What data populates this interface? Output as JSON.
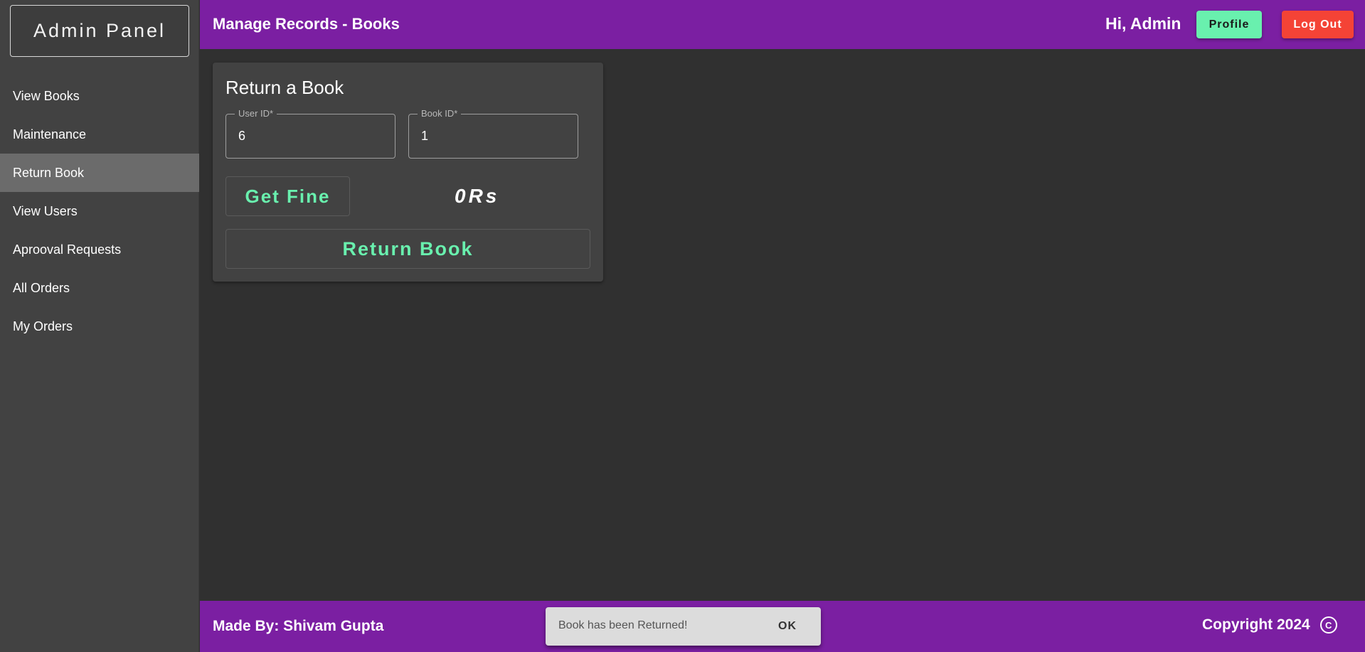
{
  "sidebar": {
    "brand": "Admin Panel",
    "items": [
      {
        "label": "View Books",
        "active": false
      },
      {
        "label": "Maintenance",
        "active": false
      },
      {
        "label": "Return Book",
        "active": true
      },
      {
        "label": "View Users",
        "active": false
      },
      {
        "label": "Aprooval Requests",
        "active": false
      },
      {
        "label": "All Orders",
        "active": false
      },
      {
        "label": "My Orders",
        "active": false
      }
    ]
  },
  "header": {
    "title": "Manage Records - Books",
    "greeting": "Hi, Admin",
    "profile_label": "Profile",
    "logout_label": "Log Out"
  },
  "card": {
    "title": "Return a Book",
    "user_id": {
      "label": "User ID*",
      "value": "6"
    },
    "book_id": {
      "label": "Book ID*",
      "value": "1"
    },
    "get_fine_label": "Get Fine",
    "fine_amount": "0Rs",
    "return_label": "Return Book"
  },
  "footer": {
    "made_by": "Made By: Shivam Gupta",
    "copyright": "Copyright 2024",
    "copyright_icon": "copyright-icon"
  },
  "snackbar": {
    "message": "Book has been Returned!",
    "action_label": "OK"
  },
  "colors": {
    "header_bg": "#7b1fa2",
    "sidebar_bg": "#424242",
    "main_bg": "#303030",
    "accent_green": "#69f0ae",
    "logout_red": "#f44336"
  }
}
